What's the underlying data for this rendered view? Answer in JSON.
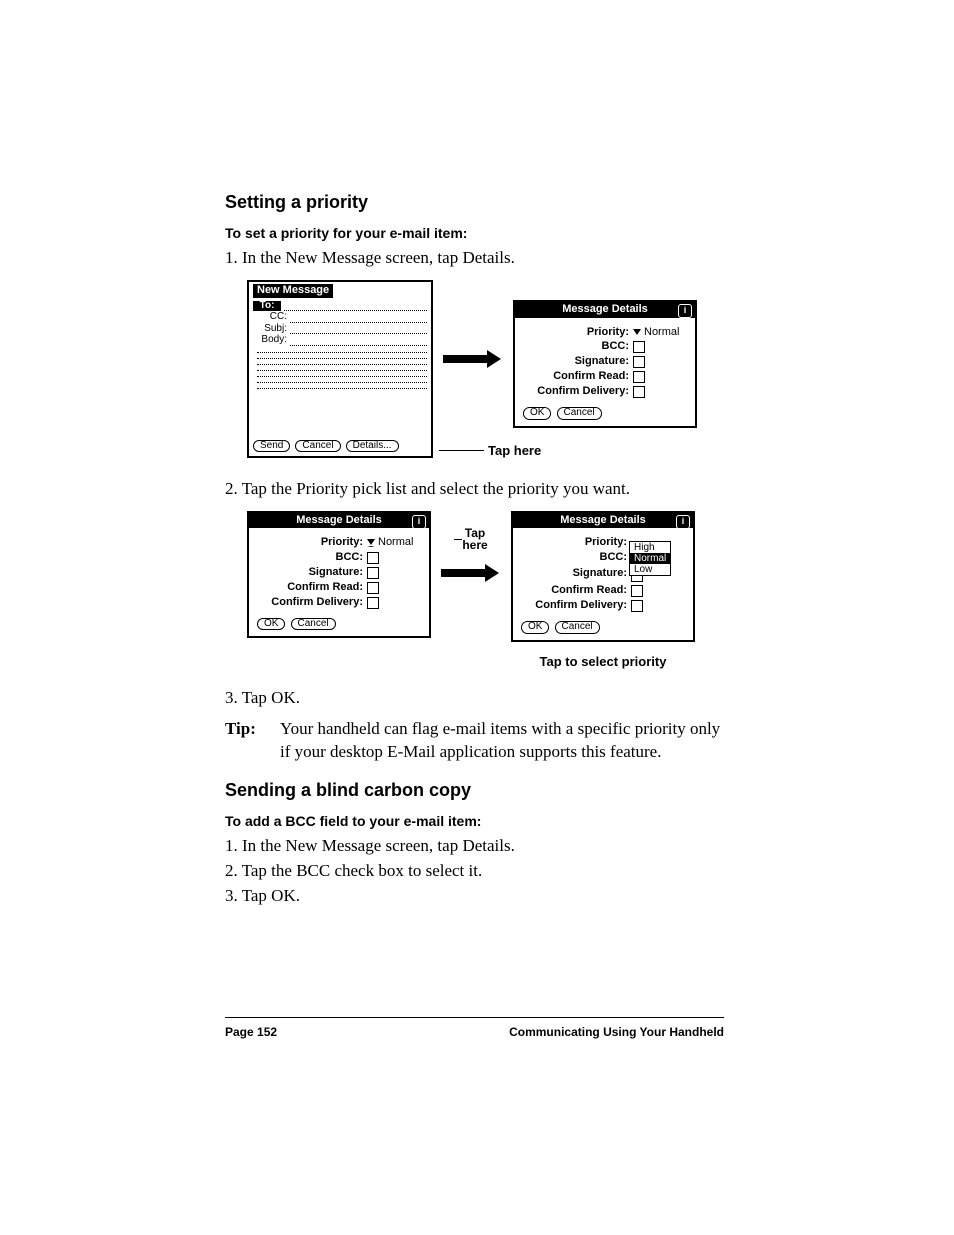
{
  "section1": {
    "heading": "Setting a priority",
    "subhead": "To set a priority for your e-mail item:",
    "steps": {
      "s1": "1.  In the New Message screen, tap Details.",
      "s2": "2.  Tap the Priority pick list and select the priority you want.",
      "s3": "3.  Tap OK."
    },
    "tip_label": "Tip:",
    "tip_body": "Your handheld can flag e-mail items with a specific priority only if your desktop E-Mail application supports this feature."
  },
  "section2": {
    "heading": "Sending a blind carbon copy",
    "subhead": "To add a BCC field to your e-mail item:",
    "steps": {
      "s1": "1.  In the New Message screen, tap Details.",
      "s2": "2.  Tap the BCC check box to select it.",
      "s3": "3.  Tap OK."
    }
  },
  "newMessage": {
    "title": "New Message",
    "fields": {
      "to": "To:",
      "cc": "CC:",
      "subj": "Subj:",
      "body": "Body:"
    },
    "buttons": {
      "send": "Send",
      "cancel": "Cancel",
      "details": "Details..."
    }
  },
  "details": {
    "title": "Message Details",
    "info": "i",
    "rows": {
      "priority": "Priority:",
      "bcc": "BCC:",
      "signature": "Signature:",
      "confirm_read": "Confirm Read:",
      "confirm_delivery": "Confirm Delivery:"
    },
    "priority_value": "Normal",
    "buttons": {
      "ok": "OK",
      "cancel": "Cancel"
    },
    "dropdown": {
      "high": "High",
      "normal": "Normal",
      "low": "Low"
    }
  },
  "callouts": {
    "tap_here": "Tap here",
    "tap_here_multiline1": "Tap",
    "tap_here_multiline2": "here",
    "tap_select": "Tap to select priority"
  },
  "footer": {
    "page": "Page 152",
    "chapter": "Communicating Using Your Handheld"
  }
}
